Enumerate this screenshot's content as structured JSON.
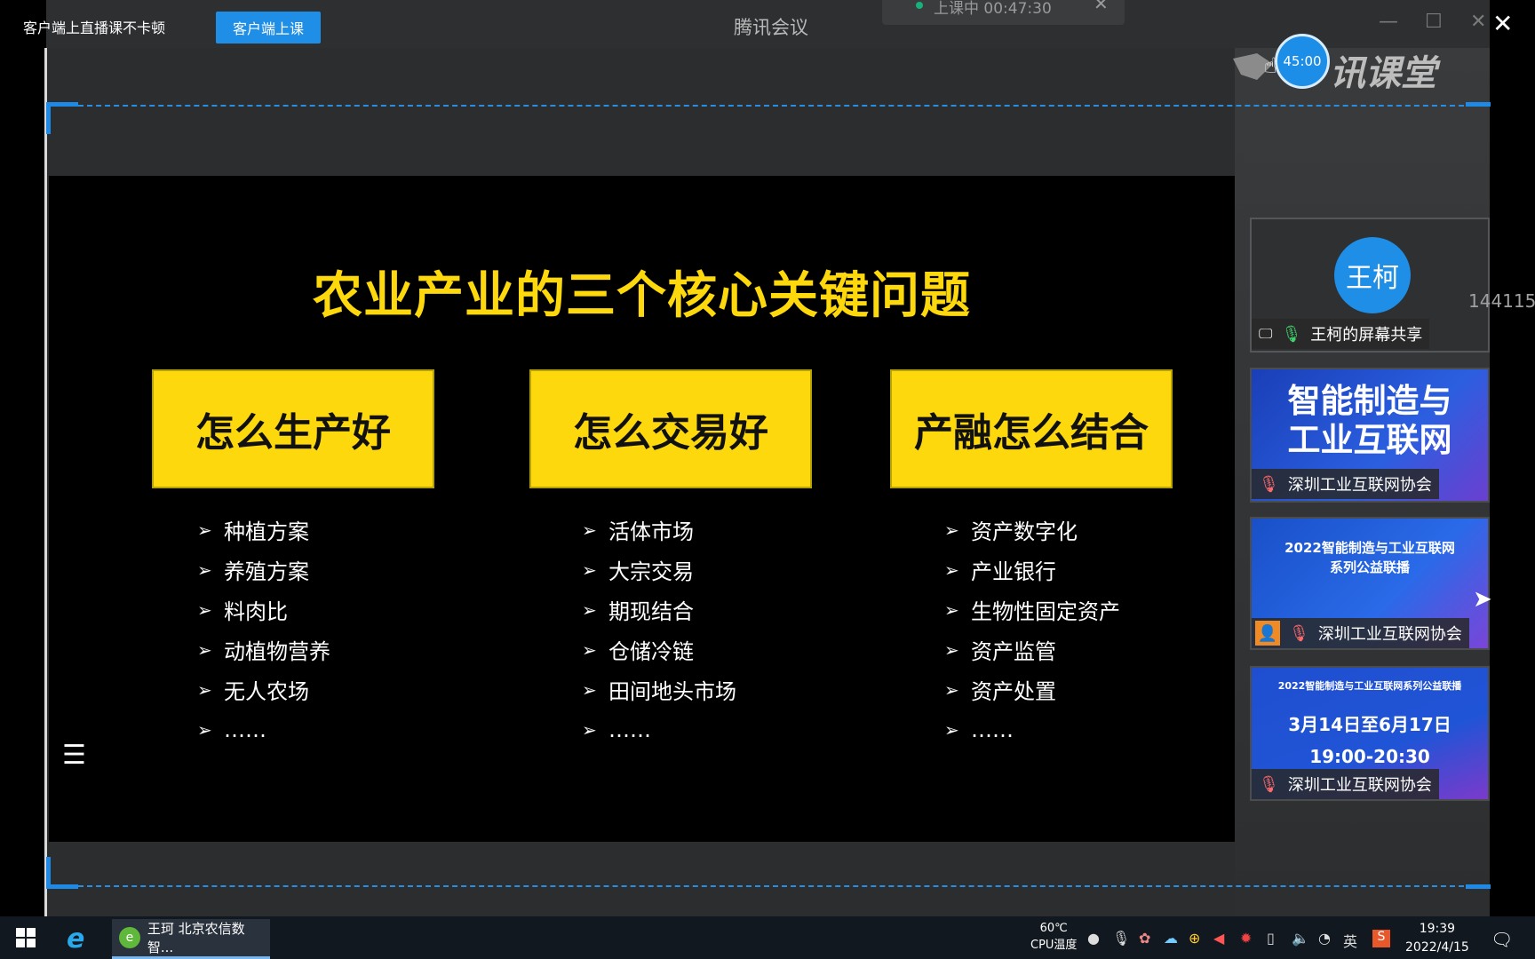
{
  "top": {
    "notice": "客户端上直播课不卡顿",
    "client_button": "客户端上课",
    "meeting_title": "腾讯会议",
    "status_text": "上课中 00:47:30"
  },
  "logo": {
    "text": "讯课堂",
    "timer": "45:00"
  },
  "slide": {
    "title": "农业产业的三个核心关键问题",
    "columns": [
      {
        "heading": "怎么生产好",
        "items": [
          "种植方案",
          "养殖方案",
          "料肉比",
          "动植物营养",
          "无人农场",
          "……"
        ]
      },
      {
        "heading": "怎么交易好",
        "items": [
          "活体市场",
          "大宗交易",
          "期现结合",
          "仓储冷链",
          "田间地头市场",
          "……"
        ]
      },
      {
        "heading": "产融怎么结合",
        "items": [
          "资产数字化",
          "产业银行",
          "生物性固定资产",
          "资产监管",
          "资产处置",
          "……"
        ]
      }
    ]
  },
  "participants": {
    "presenter_avatar": "王柯",
    "presenter_label": "王柯的屏幕共享",
    "user_id": "144115",
    "tile2_poster_line1": "智能制造与",
    "tile2_poster_line2": "工业互联网",
    "tile2_label": "深圳工业互联网协会",
    "tile3_poster_title": "2022智能制造与工业互联网",
    "tile3_poster_subtitle": "系列公益联播",
    "tile3_label": "深圳工业互联网协会",
    "tile4_poster_title": "2022智能制造与工业互联网系列公益联播",
    "tile4_dates": "3月14日至6月17日",
    "tile4_time": "19:00-20:30",
    "tile4_label": "深圳工业互联网协会"
  },
  "taskbar": {
    "app_label": "王珂 北京农信数智...",
    "temp_value": "60℃",
    "temp_label": "CPU温度",
    "ime": "英",
    "time": "19:39",
    "date": "2022/4/15"
  },
  "colors": {
    "accent": "#1e8ee6",
    "slide_yellow": "#fcd80c"
  }
}
